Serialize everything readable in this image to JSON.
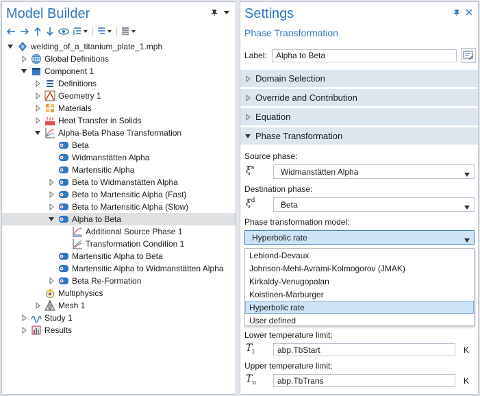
{
  "model_builder": {
    "title": "Model Builder",
    "tree": [
      {
        "label": "welding_of_a_titanium_plate_1.mph",
        "icon": "mph-file-icon",
        "depth": 0,
        "twisty": "expanded"
      },
      {
        "label": "Global Definitions",
        "icon": "globe-icon",
        "depth": 1,
        "twisty": "collapsed"
      },
      {
        "label": "Component 1",
        "icon": "component-icon",
        "depth": 1,
        "twisty": "expanded"
      },
      {
        "label": "Definitions",
        "icon": "definitions-icon",
        "depth": 2,
        "twisty": "collapsed"
      },
      {
        "label": "Geometry 1",
        "icon": "geometry-icon",
        "depth": 2,
        "twisty": "collapsed"
      },
      {
        "label": "Materials",
        "icon": "materials-icon",
        "depth": 2,
        "twisty": "collapsed"
      },
      {
        "label": "Heat Transfer in Solids",
        "icon": "heat-transfer-icon",
        "depth": 2,
        "twisty": "collapsed"
      },
      {
        "label": "Alpha-Beta Phase Transformation",
        "icon": "phase-transformation-icon",
        "depth": 2,
        "twisty": "expanded"
      },
      {
        "label": "Beta",
        "icon": "phase-icon",
        "depth": 3,
        "twisty": "none"
      },
      {
        "label": "Widmanstätten Alpha",
        "icon": "phase-icon",
        "depth": 3,
        "twisty": "none"
      },
      {
        "label": "Martensitic Alpha",
        "icon": "phase-icon",
        "depth": 3,
        "twisty": "none"
      },
      {
        "label": "Beta to Widmanstätten Alpha",
        "icon": "phase-transition-icon",
        "depth": 3,
        "twisty": "collapsed"
      },
      {
        "label": "Beta to Martensitic Alpha (Fast)",
        "icon": "phase-transition-icon",
        "depth": 3,
        "twisty": "collapsed"
      },
      {
        "label": "Beta to Martensitic Alpha (Slow)",
        "icon": "phase-transition-icon",
        "depth": 3,
        "twisty": "collapsed"
      },
      {
        "label": "Alpha to Beta",
        "icon": "phase-transition-icon",
        "depth": 3,
        "twisty": "expanded",
        "selected": true
      },
      {
        "label": "Additional Source Phase 1",
        "icon": "source-phase-icon",
        "depth": 4,
        "twisty": "none"
      },
      {
        "label": "Transformation Condition 1",
        "icon": "condition-icon",
        "depth": 4,
        "twisty": "none"
      },
      {
        "label": "Martensitic Alpha to Beta",
        "icon": "phase-transition-icon",
        "depth": 3,
        "twisty": "none"
      },
      {
        "label": "Martensitic Alpha to Widmanstätten Alpha",
        "icon": "phase-transition-icon",
        "depth": 3,
        "twisty": "none"
      },
      {
        "label": "Beta Re-Formation",
        "icon": "phase-transition-icon",
        "depth": 3,
        "twisty": "collapsed"
      },
      {
        "label": "Multiphysics",
        "icon": "multiphysics-icon",
        "depth": 2,
        "twisty": "none"
      },
      {
        "label": "Mesh 1",
        "icon": "mesh-icon",
        "depth": 2,
        "twisty": "collapsed"
      },
      {
        "label": "Study 1",
        "icon": "study-icon",
        "depth": 1,
        "twisty": "collapsed"
      },
      {
        "label": "Results",
        "icon": "results-icon",
        "depth": 1,
        "twisty": "collapsed"
      }
    ]
  },
  "settings": {
    "title": "Settings",
    "subtitle": "Phase Transformation",
    "label_caption": "Label:",
    "label_value": "Alpha to Beta",
    "sections": [
      {
        "title": "Domain Selection",
        "expanded": false
      },
      {
        "title": "Override and Contribution",
        "expanded": false
      },
      {
        "title": "Equation",
        "expanded": false
      },
      {
        "title": "Phase Transformation",
        "expanded": true
      }
    ],
    "source_phase_label": "Source phase:",
    "source_symbol": "ξ",
    "source_symbol_sup": "s",
    "source_phase_value": "Widmanstätten Alpha",
    "destination_phase_label": "Destination phase:",
    "destination_symbol": "ξ",
    "destination_symbol_sup": "d",
    "destination_phase_value": "Beta",
    "model_label": "Phase transformation model:",
    "model_value": "Hyperbolic rate",
    "model_options": [
      "Leblond-Devaux",
      "Johnson-Mehl-Avrami-Kolmogorov (JMAK)",
      "Kirkaldy-Venugopalan",
      "Koistinen-Marburger",
      "Hyperbolic rate",
      "User defined"
    ],
    "lower_temp_label": "Lower temperature limit:",
    "lower_symbol": "T",
    "lower_symbol_sub": "l",
    "lower_temp_value": "abp.TbStart",
    "lower_temp_unit": "K",
    "upper_temp_label": "Upper temperature limit:",
    "upper_symbol": "T",
    "upper_symbol_sub": "u",
    "upper_temp_value": "abp.TbTrans",
    "upper_temp_unit": "K"
  },
  "colors": {
    "accent": "#2f76c0",
    "section_bg": "#dde6ef",
    "selected_row": "#dfe0e2",
    "dropdown_highlight": "#cfe3f7"
  }
}
